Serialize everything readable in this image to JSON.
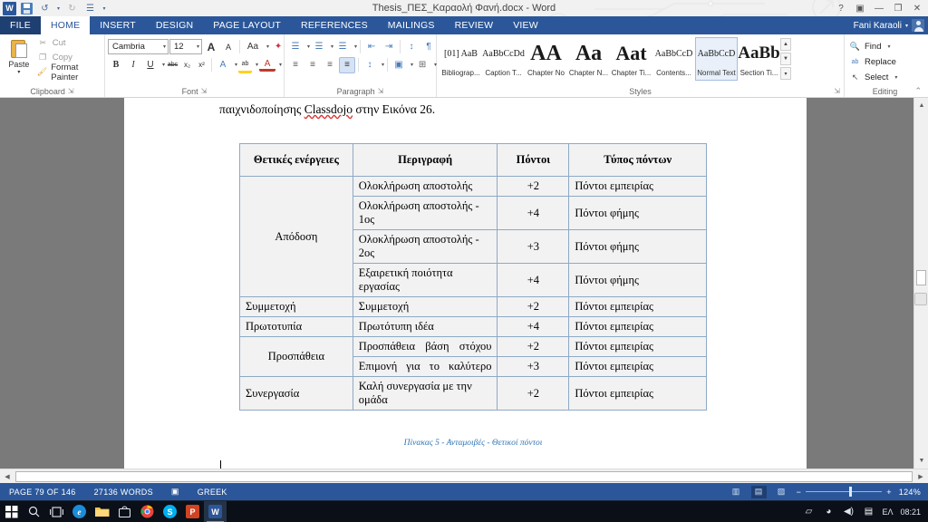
{
  "window": {
    "title": "Thesis_ΠΕΣ_Καραολή Φανή.docx - Word",
    "help_label": "?",
    "ribbon_display_label": "▣",
    "minimize_label": "—",
    "restore_label": "❐",
    "close_label": "✕"
  },
  "quick_access": {
    "word_logo": "W",
    "items": [
      {
        "name": "save-icon",
        "label": ""
      },
      {
        "name": "undo-icon",
        "label": "↺"
      },
      {
        "name": "undo-dropdown-icon",
        "label": "▾"
      },
      {
        "name": "redo-icon",
        "label": "↻"
      },
      {
        "name": "touch-mode-icon",
        "label": "☰"
      },
      {
        "name": "customize-qat-icon",
        "label": "▾"
      }
    ]
  },
  "tabs": [
    {
      "label": "FILE",
      "state": "file"
    },
    {
      "label": "HOME",
      "state": "active"
    },
    {
      "label": "INSERT",
      "state": ""
    },
    {
      "label": "DESIGN",
      "state": ""
    },
    {
      "label": "PAGE LAYOUT",
      "state": ""
    },
    {
      "label": "REFERENCES",
      "state": ""
    },
    {
      "label": "MAILINGS",
      "state": ""
    },
    {
      "label": "REVIEW",
      "state": ""
    },
    {
      "label": "VIEW",
      "state": ""
    }
  ],
  "account": {
    "user_name": "Fani Karaoli",
    "dropdown_caret": "▾"
  },
  "ribbon": {
    "clipboard": {
      "group_label": "Clipboard",
      "paste_label": "Paste",
      "paste_caret": "▾",
      "cut_label": "Cut",
      "copy_label": "Copy",
      "format_painter_label": "Format Painter",
      "cut_icon": "✂",
      "copy_icon": "❐",
      "format_painter_icon": "🖌",
      "dialog_launcher": "⇲"
    },
    "font": {
      "group_label": "Font",
      "font_family_value": "Cambria",
      "font_size_value": "12",
      "grow_font": "A",
      "shrink_font": "A",
      "change_case": "Aa",
      "clear_formatting": "✦",
      "bold": "B",
      "italic": "I",
      "underline": "U",
      "strikethrough": "abc",
      "subscript": "x₂",
      "superscript": "x²",
      "text_effects": "A",
      "highlight": "ab",
      "font_color": "A",
      "dialog_launcher": "⇲"
    },
    "paragraph": {
      "group_label": "Paragraph",
      "bullets": "☰",
      "numbering": "☰",
      "multilevel": "☰",
      "decrease_indent": "⇤",
      "increase_indent": "⇥",
      "sort": "↕",
      "show_marks": "¶",
      "align_left": "≡",
      "align_center": "≡",
      "align_right": "≡",
      "justify": "≡",
      "line_spacing": "↕",
      "shading": "▣",
      "borders": "⊞",
      "dialog_launcher": "⇲"
    },
    "styles": {
      "group_label": "Styles",
      "dialog_launcher": "⇲",
      "scroll_up": "▲",
      "scroll_down": "▼",
      "more": "▾",
      "items": [
        {
          "preview": "[01] AaB",
          "name": "Bibliograp...",
          "selected": false
        },
        {
          "preview": "AaBbCcDd",
          "name": "Caption T...",
          "selected": false
        },
        {
          "preview": "AA",
          "name": "Chapter No",
          "selected": false
        },
        {
          "preview": "Aa",
          "name": "Chapter N...",
          "selected": false
        },
        {
          "preview": "Aat",
          "name": "Chapter Ti...",
          "selected": false
        },
        {
          "preview": "AaBbCcD",
          "name": "Contents...",
          "selected": false
        },
        {
          "preview": "AaBbCcD",
          "name": "Normal Text",
          "selected": true
        },
        {
          "preview": "AaBb",
          "name": "Section Ti...",
          "selected": false
        }
      ]
    },
    "editing": {
      "group_label": "Editing",
      "find_label": "Find",
      "find_caret": "▾",
      "replace_label": "Replace",
      "select_label": "Select",
      "select_caret": "▾",
      "find_icon": "🔍",
      "replace_icon": "ab",
      "select_icon": "↖",
      "collapse_ribbon": "⌃"
    }
  },
  "document": {
    "paragraph_before": "παιχνιδοποίησης ",
    "paragraph_spellerror": "Classdojo",
    "paragraph_after": " στην Εικόνα 26.",
    "table": {
      "headers": [
        "Θετικές ενέργειες",
        "Περιγραφή",
        "Πόντοι",
        "Τύπος πόντων"
      ],
      "rows": [
        {
          "category": "Απόδοση",
          "category_span": 4,
          "description": "Ολοκλήρωση αποστολής",
          "points": "+2",
          "type": "Πόντοι εμπειρίας"
        },
        {
          "category": null,
          "description": "Ολοκλήρωση αποστολής - 1ος",
          "points": "+4",
          "type": "Πόντοι φήμης"
        },
        {
          "category": null,
          "description": "Ολοκλήρωση αποστολής - 2ος",
          "points": "+3",
          "type": "Πόντοι φήμης"
        },
        {
          "category": null,
          "description": "Εξαιρετική ποιότητα εργασίας",
          "points": "+4",
          "type": "Πόντοι φήμης"
        },
        {
          "category": "Συμμετοχή",
          "category_span": 1,
          "description": "Συμμετοχή",
          "points": "+2",
          "type": "Πόντοι εμπειρίας"
        },
        {
          "category": "Πρωτοτυπία",
          "category_span": 1,
          "description": "Πρωτότυπη ιδέα",
          "points": "+4",
          "type": "Πόντοι εμπειρίας"
        },
        {
          "category": "Προσπάθεια",
          "category_span": 2,
          "description": "Προσπάθεια βάση στόχου",
          "points": "+2",
          "type": "Πόντοι εμπειρίας"
        },
        {
          "category": null,
          "description": "Επιμονή για το καλύτερο",
          "points": "+3",
          "type": "Πόντοι εμπειρίας"
        },
        {
          "category": "Συνεργασία",
          "category_span": 1,
          "description": "Καλή συνεργασία με την ομάδα",
          "points": "+2",
          "type": "Πόντοι εμπειρίας"
        }
      ]
    },
    "caption": "Πίνακας 5 - Ανταμοιβές - Θετικοί πόντοι"
  },
  "scrollbars": {
    "up_arrow": "▲",
    "down_arrow": "▼",
    "left_arrow": "◀",
    "right_arrow": "▶",
    "browse_object": "◉"
  },
  "status_bar": {
    "page_label": "PAGE 79 OF 146",
    "word_count_label": "27136 WORDS",
    "proofing_icon": "▣",
    "language_label": "GREEK",
    "view_read_mode": "▥",
    "view_print_layout": "▤",
    "view_web_layout": "▨",
    "zoom_out": "−",
    "zoom_in": "+",
    "zoom_level": "124%"
  },
  "taskbar": {
    "start_icon": "⊞",
    "search_icon": "🔍",
    "task_view_icon": "❐",
    "apps": [
      {
        "name": "edge",
        "glyph": "e",
        "color": "#1b8cd8",
        "active": false
      },
      {
        "name": "file-explorer",
        "glyph": "🗀",
        "color": "#f2c14e",
        "active": false
      },
      {
        "name": "store",
        "glyph": "🛍",
        "color": "#d8d8d8",
        "active": false
      },
      {
        "name": "chrome",
        "glyph": "◉",
        "color": "#e8453c",
        "active": false
      },
      {
        "name": "skype",
        "glyph": "S",
        "color": "#00aff0",
        "active": false
      },
      {
        "name": "powerpoint",
        "glyph": "P",
        "color": "#d04423",
        "active": false
      },
      {
        "name": "word",
        "glyph": "W",
        "color": "#2b579a",
        "active": true
      }
    ],
    "tray": {
      "hidden_icons": "▱",
      "network_icon": "◕",
      "volume_icon": "◀)",
      "action_center_icon": "▤",
      "language_label": "ΕΛ",
      "clock": "08:21"
    }
  }
}
